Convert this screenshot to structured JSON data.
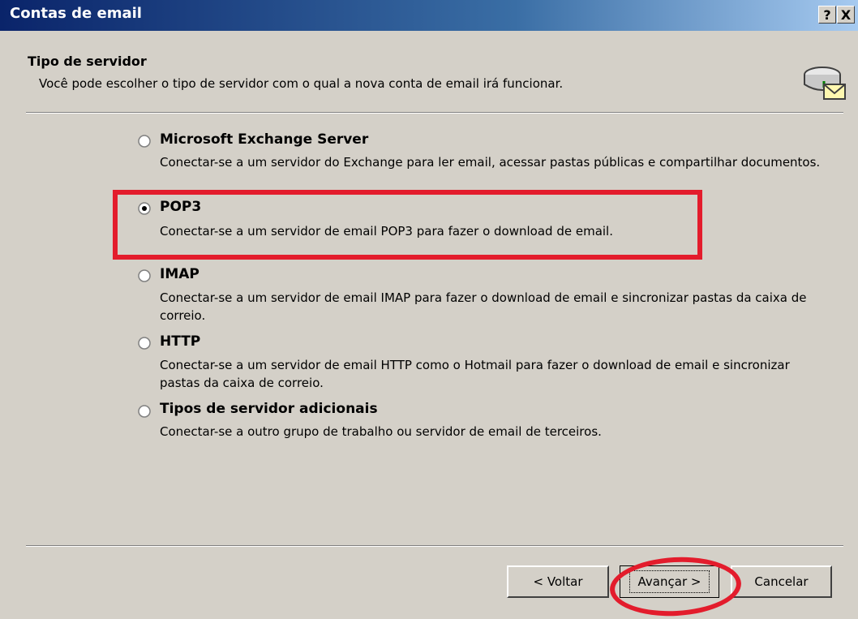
{
  "window": {
    "title": "Contas de email",
    "help_glyph": "?",
    "close_glyph": "X"
  },
  "header": {
    "title": "Tipo de servidor",
    "subtitle": "Você pode escolher o tipo de servidor com o qual a nova conta de email irá funcionar.",
    "icon": "mail-server-icon"
  },
  "options": [
    {
      "label": "Microsoft Exchange Server",
      "description": "Conectar-se a um servidor do Exchange para ler email, acessar pastas públicas e compartilhar documentos.",
      "selected": false
    },
    {
      "label": "POP3",
      "description": "Conectar-se a um servidor de email POP3 para fazer o download de email.",
      "selected": true
    },
    {
      "label": "IMAP",
      "description": "Conectar-se a um servidor de email IMAP para fazer o download de email e sincronizar pastas da caixa de correio.",
      "selected": false
    },
    {
      "label": "HTTP",
      "description": "Conectar-se a um servidor de email HTTP como o Hotmail para fazer o download de email e sincronizar pastas da caixa de correio.",
      "selected": false
    },
    {
      "label": "Tipos de servidor adicionais",
      "description": "Conectar-se a outro grupo de trabalho ou servidor de email de terceiros.",
      "selected": false
    }
  ],
  "buttons": {
    "back": "< Voltar",
    "next": "Avançar >",
    "cancel": "Cancelar"
  },
  "annotation_color": "#e31c2c"
}
